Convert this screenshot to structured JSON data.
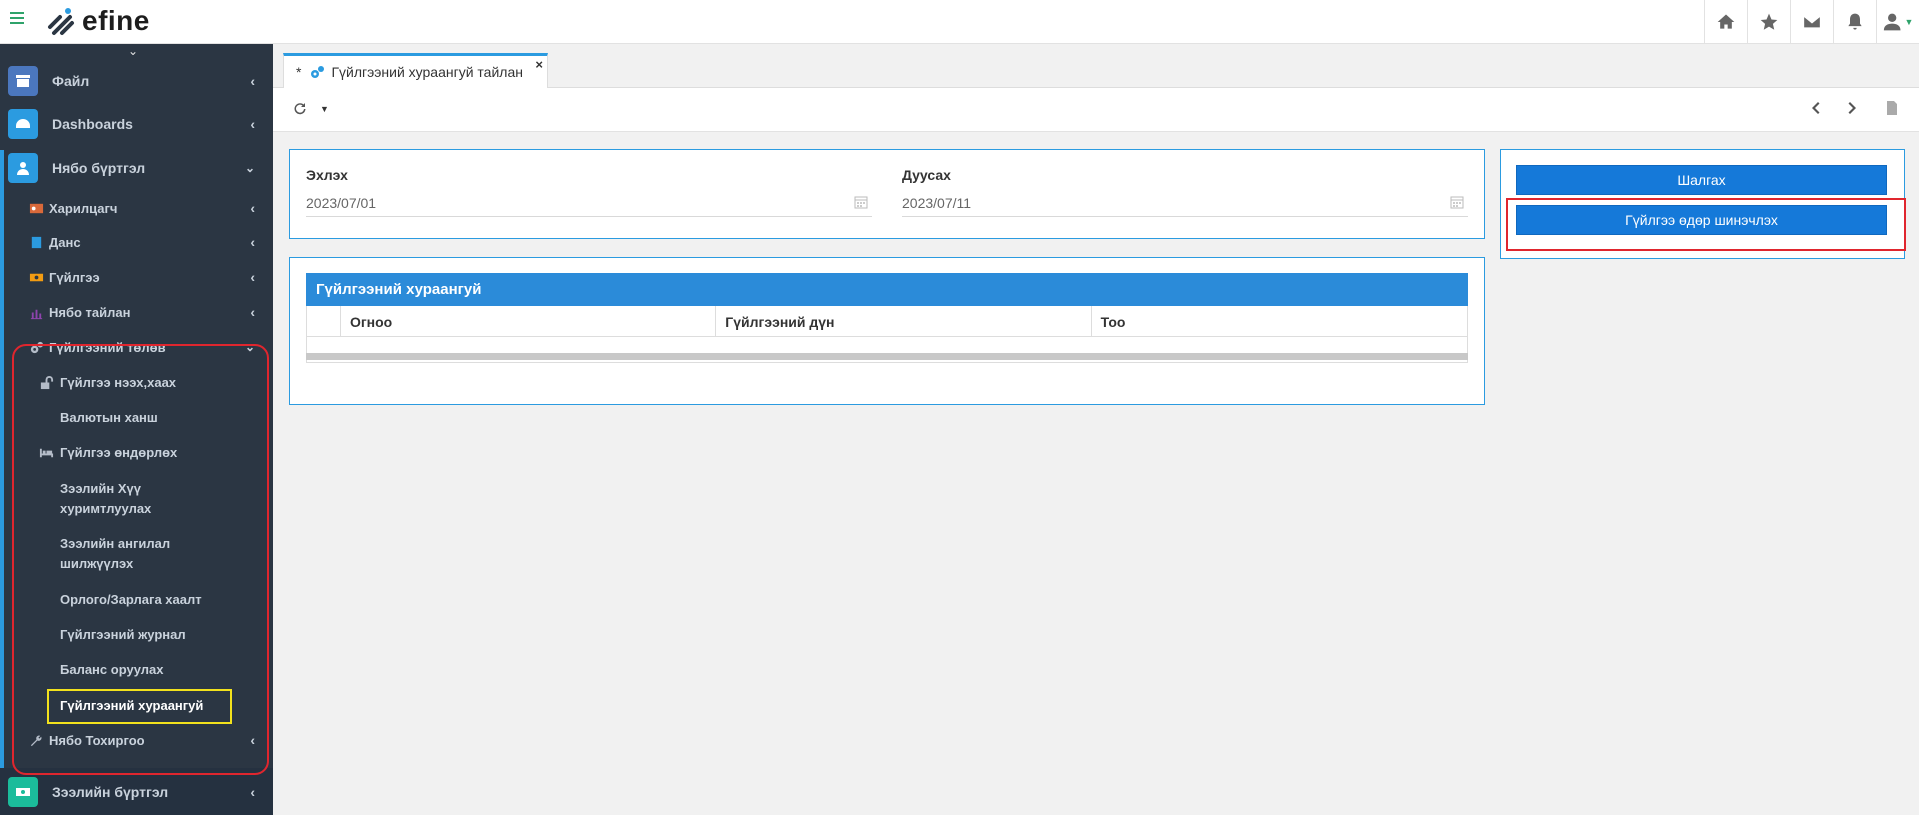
{
  "header": {
    "logo_text": "efine",
    "icons": [
      "home-icon",
      "star-icon",
      "envelope-icon",
      "bell-icon",
      "user-icon"
    ]
  },
  "sidebar": {
    "top_items": [
      {
        "label": "Файл",
        "icon": "archive-icon",
        "color": "#4b77be"
      },
      {
        "label": "Dashboards",
        "icon": "dashboard-icon",
        "color": "#2b9be0"
      },
      {
        "label": "Нябо бүртгэл",
        "icon": "user-icon",
        "color": "#2b9be0"
      }
    ],
    "sub_items": [
      {
        "label": "Харилцагч",
        "icon": "id-card-icon"
      },
      {
        "label": "Данс",
        "icon": "book-icon"
      },
      {
        "label": "Гүйлгээ",
        "icon": "money-icon"
      },
      {
        "label": "Нябо тайлан",
        "icon": "bar-chart-icon"
      },
      {
        "label": "Гүйлгээний төлөв",
        "icon": "cogs-icon"
      }
    ],
    "status_items": [
      {
        "label": "Гүйлгээ нээх,хаах",
        "icon": "unlock-icon"
      },
      {
        "label": "Валютын ханш",
        "icon": ""
      },
      {
        "label": "Гүйлгээ өндөрлөх",
        "icon": "bed-icon"
      }
    ],
    "multi_items": [
      {
        "line1": "Зээлийн Хүү",
        "line2": "хуримтлуулах"
      },
      {
        "line1": "Зээлийн ангилал",
        "line2": "шилжүүлэх"
      }
    ],
    "single_items": [
      "Орлого/Зарлага хаалт",
      "Гүйлгээний журнал",
      "Баланс оруулах",
      "Гүйлгээний хураангуй"
    ],
    "settings_item": "Нябо Тохиргоо",
    "bottom_item": "Зээлийн бүртгэл"
  },
  "tab": {
    "marker": "*",
    "label": "Гүйлгээний хураангуй тайлан",
    "close": "×"
  },
  "form": {
    "start_label": "Эхлэх",
    "start_value": "2023/07/01",
    "end_label": "Дуусах",
    "end_value": "2023/07/11"
  },
  "actions": {
    "check_button": "Шалгах",
    "update_button": "Гүйлгээ өдөр шинэчлэх"
  },
  "grid": {
    "title": "Гүйлгээний хураангуй",
    "columns": [
      "Огноо",
      "Гүйлгээний дүн",
      "Тоо"
    ]
  }
}
